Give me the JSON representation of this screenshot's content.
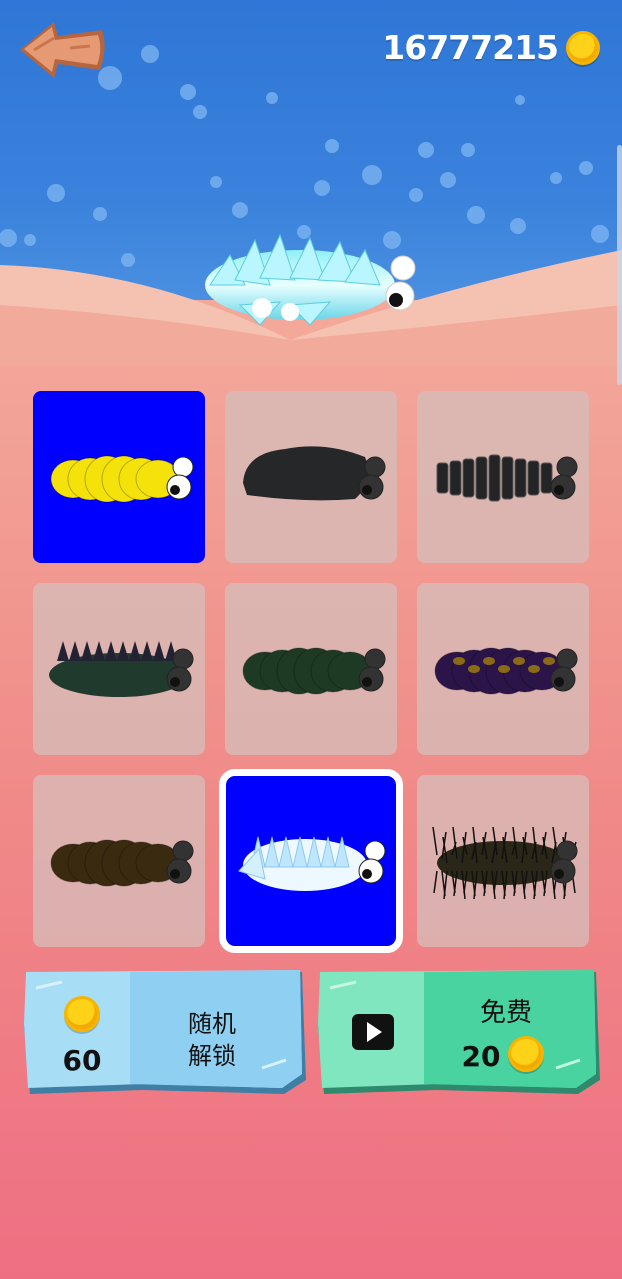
{
  "header": {
    "coins": "16777215",
    "back_icon": "arrow-left-icon",
    "coin_icon": "coin-icon"
  },
  "grid": {
    "items": [
      {
        "id": "yellow",
        "color": "#f5e20b",
        "style": "smooth",
        "selected": true,
        "equipped": false
      },
      {
        "id": "black-rock",
        "color": "#262729",
        "style": "rock",
        "selected": false,
        "equipped": false
      },
      {
        "id": "black-plates",
        "color": "#232425",
        "style": "plates",
        "selected": false,
        "equipped": false
      },
      {
        "id": "green-spiky",
        "color": "#213a2e",
        "style": "spiky",
        "selected": false,
        "equipped": false
      },
      {
        "id": "green-smooth",
        "color": "#1e3a25",
        "style": "smooth",
        "selected": false,
        "equipped": false
      },
      {
        "id": "purple-gold",
        "color": "#2a1448",
        "style": "dotted",
        "selected": false,
        "equipped": false
      },
      {
        "id": "brown",
        "color": "#3a2a10",
        "style": "smooth",
        "selected": false,
        "equipped": false
      },
      {
        "id": "crystal",
        "color": "#cfe9ff",
        "style": "crystal",
        "selected": true,
        "equipped": true
      },
      {
        "id": "hairy",
        "color": "#2a2618",
        "style": "hairy",
        "selected": false,
        "equipped": false
      }
    ]
  },
  "buttons": {
    "random_unlock": {
      "line1": "随机",
      "line2": "解锁",
      "price": "60"
    },
    "free": {
      "label": "免费",
      "reward": "20",
      "icon": "play-video-icon"
    }
  },
  "colors": {
    "sky": "#2f76d6",
    "selected_tile": "#0000ff",
    "ice_button": "#a8dcf5",
    "mint_button": "#4ed8a8"
  }
}
